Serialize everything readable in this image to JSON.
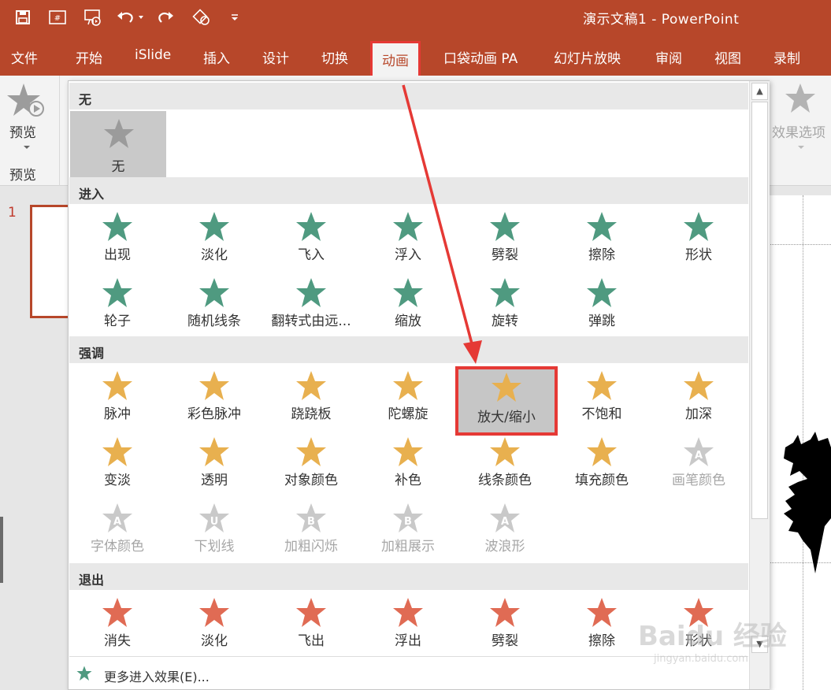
{
  "title_bar": {
    "title": "演示文稿1  -  PowerPoint"
  },
  "tabs": [
    "文件",
    "开始",
    "iSlide",
    "插入",
    "设计",
    "切换",
    "动画",
    "口袋动画 PA",
    "幻灯片放映",
    "审阅",
    "视图",
    "录制"
  ],
  "ribbon": {
    "preview_label": "预览",
    "preview_group": "预览",
    "effect_options": "效果选项"
  },
  "slide": {
    "number": "1"
  },
  "gallery": {
    "sections": {
      "none": "无",
      "entrance": "进入",
      "emphasis": "强调",
      "exit": "退出"
    },
    "none_item": "无",
    "entrance": [
      "出现",
      "淡化",
      "飞入",
      "浮入",
      "劈裂",
      "擦除",
      "形状",
      "轮子",
      "随机线条",
      "翻转式由远...",
      "缩放",
      "旋转",
      "弹跳"
    ],
    "emphasis": [
      "脉冲",
      "彩色脉冲",
      "跷跷板",
      "陀螺旋",
      "放大/缩小",
      "不饱和",
      "加深",
      "变淡",
      "透明",
      "对象颜色",
      "补色",
      "线条颜色",
      "填充颜色",
      "画笔颜色",
      "字体颜色",
      "下划线",
      "加粗闪烁",
      "加粗展示",
      "波浪形"
    ],
    "exit": [
      "消失",
      "淡化",
      "飞出",
      "浮出",
      "劈裂",
      "擦除",
      "形状"
    ],
    "more": "更多进入效果(E)..."
  },
  "colors": {
    "accent": "#b7472a",
    "entrance_star": "#4f9a80",
    "emphasis_star": "#e8b04f",
    "exit_star": "#e06b54",
    "highlight": "#e53935"
  },
  "watermark": {
    "brand": "Baidu 经验",
    "url": "jingyan.baidu.com"
  }
}
